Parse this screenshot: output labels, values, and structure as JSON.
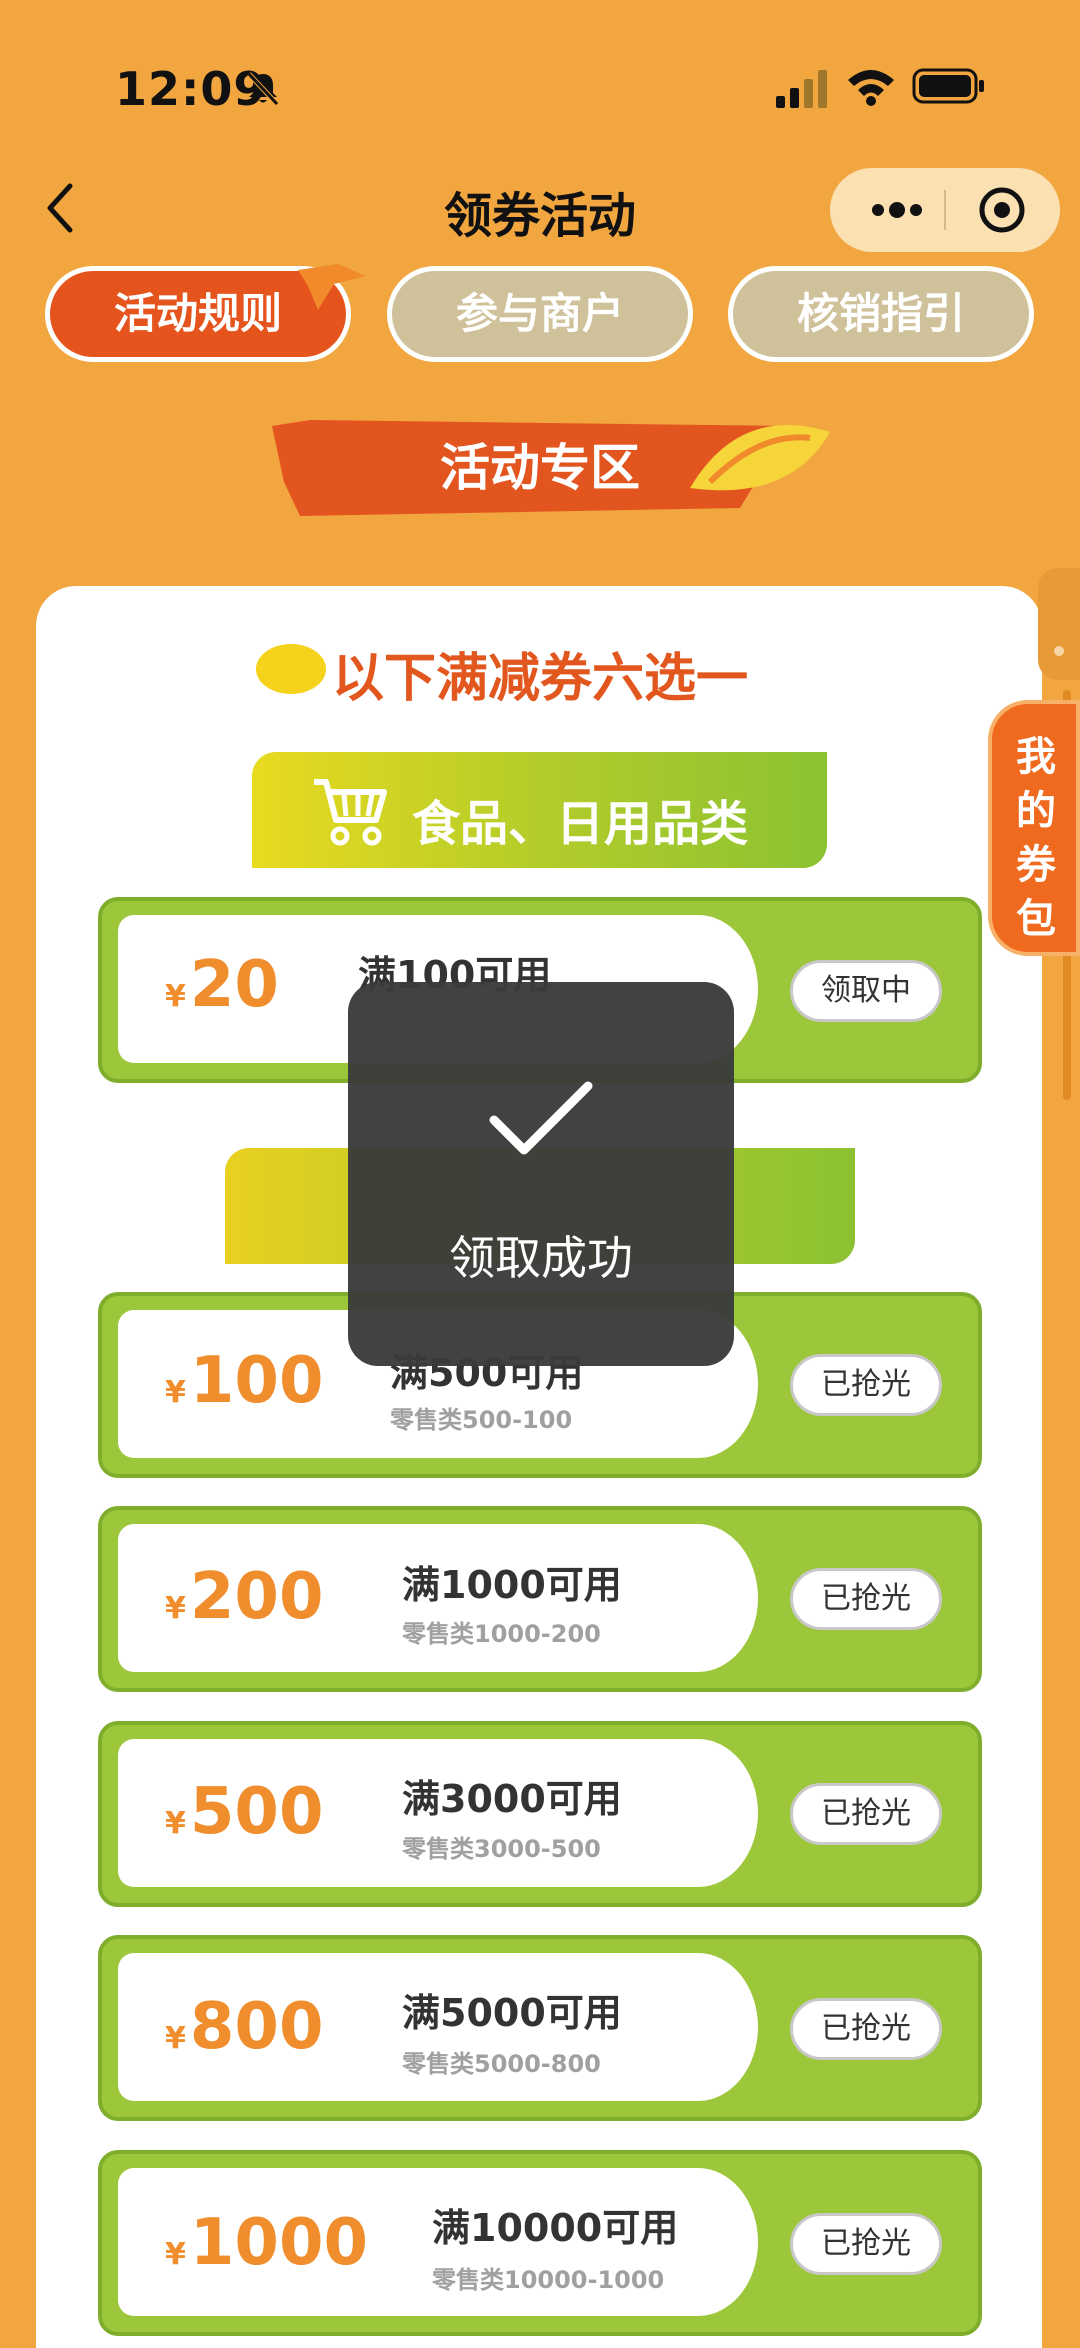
{
  "status_bar": {
    "time": "12:09"
  },
  "nav": {
    "title": "领券活动"
  },
  "tabs": [
    {
      "label": "活动规则",
      "active": true
    },
    {
      "label": "参与商户",
      "active": false
    },
    {
      "label": "核销指引",
      "active": false
    }
  ],
  "section_title": "活动专区",
  "heading": "以下满减券六选一",
  "category": {
    "label": "食品、日用品类"
  },
  "side_tab": {
    "chars": [
      "我",
      "的",
      "券",
      "包"
    ]
  },
  "coupons": [
    {
      "currency": "¥",
      "amount": "20",
      "condition": "满100可用",
      "detail": "",
      "status": "领取中"
    },
    {
      "currency": "¥",
      "amount": "100",
      "condition": "满500可用",
      "detail": "零售类500-100",
      "status": "已抢光"
    },
    {
      "currency": "¥",
      "amount": "200",
      "condition": "满1000可用",
      "detail": "零售类1000-200",
      "status": "已抢光"
    },
    {
      "currency": "¥",
      "amount": "500",
      "condition": "满3000可用",
      "detail": "零售类3000-500",
      "status": "已抢光"
    },
    {
      "currency": "¥",
      "amount": "800",
      "condition": "满5000可用",
      "detail": "零售类5000-800",
      "status": "已抢光"
    },
    {
      "currency": "¥",
      "amount": "1000",
      "condition": "满10000可用",
      "detail": "零售类10000-1000",
      "status": "已抢光"
    }
  ],
  "toast": {
    "message": "领取成功",
    "icon": "checkmark-icon"
  },
  "colors": {
    "background": "#f2a63f",
    "accent": "#e6541e",
    "coupon_green": "#9cc73a",
    "amount_orange": "#f08d2c"
  }
}
